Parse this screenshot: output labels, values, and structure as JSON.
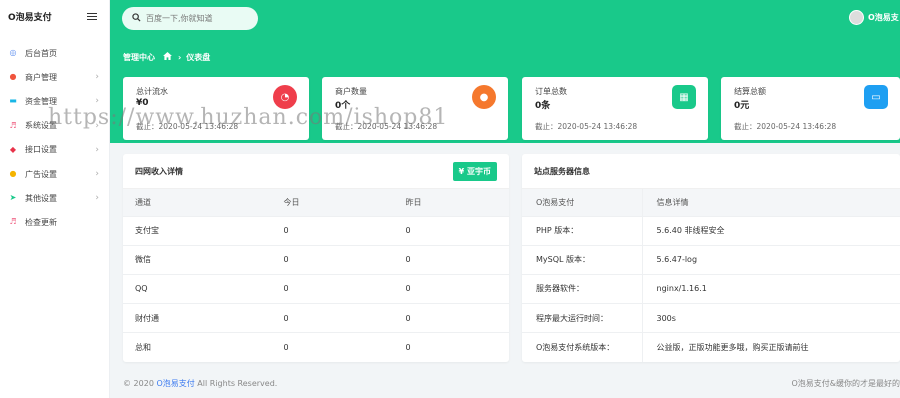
{
  "brand": {
    "name": "O泡易支付"
  },
  "sidebar": {
    "items": [
      {
        "label": "后台首页",
        "icon": "dashboard-icon",
        "color": "#5b8def",
        "has_children": false
      },
      {
        "label": "商户管理",
        "icon": "user-icon",
        "color": "#f0543d",
        "has_children": true
      },
      {
        "label": "资金管理",
        "icon": "card-icon",
        "color": "#19b6e6",
        "has_children": true
      },
      {
        "label": "系统设置",
        "icon": "settings-icon",
        "color": "#f06a8a",
        "has_children": true
      },
      {
        "label": "接口设置",
        "icon": "plug-icon",
        "color": "#e8334a",
        "has_children": true
      },
      {
        "label": "广告设置",
        "icon": "ad-icon",
        "color": "#f5b400",
        "has_children": true
      },
      {
        "label": "其他设置",
        "icon": "send-icon",
        "color": "#19c98a",
        "has_children": true
      },
      {
        "label": "检查更新",
        "icon": "refresh-icon",
        "color": "#f06a8a",
        "has_children": false
      }
    ]
  },
  "search": {
    "placeholder": "百度一下,你就知道"
  },
  "user": {
    "name": "O泡易支"
  },
  "breadcrumb": {
    "section": "管理中心",
    "page": "仪表盘"
  },
  "stats": [
    {
      "title": "总计流水",
      "value": "¥0",
      "sub": "截止：2020-05-24 13:46:28",
      "icon": "pie-icon",
      "color": "#ef3e4b"
    },
    {
      "title": "商户数量",
      "value": "0个",
      "sub": "截止：2020-05-24 13:46:28",
      "icon": "user-icon",
      "color": "#f5782d"
    },
    {
      "title": "订单总数",
      "value": "0条",
      "sub": "截止：2020-05-24 13:46:28",
      "icon": "cart-icon",
      "color": "#19c98a"
    },
    {
      "title": "结算总额",
      "value": "0元",
      "sub": "截止：2020-05-24 13:46:28",
      "icon": "wallet-icon",
      "color": "#1e9ff2"
    }
  ],
  "income": {
    "title": "四网收入详情",
    "button": "¥ 亚宇币",
    "columns": [
      "通道",
      "今日",
      "昨日"
    ],
    "rows": [
      [
        "支付宝",
        "0",
        "0"
      ],
      [
        "微信",
        "0",
        "0"
      ],
      [
        "QQ",
        "0",
        "0"
      ],
      [
        "财付通",
        "0",
        "0"
      ],
      [
        "总和",
        "0",
        "0"
      ]
    ]
  },
  "server": {
    "title": "站点服务器信息",
    "columns": [
      "O泡易支付",
      "信息详情"
    ],
    "rows": [
      [
        "PHP 版本：",
        "5.6.40 非线程安全"
      ],
      [
        "MySQL 版本：",
        "5.6.47-log"
      ],
      [
        "服务器软件：",
        "nginx/1.16.1"
      ],
      [
        "程序最大运行时间：",
        "300s"
      ],
      [
        "O泡易支付系统版本：",
        "公益版，正版功能更多哦，购买正版请前往"
      ]
    ]
  },
  "footer": {
    "copyright": "© 2020",
    "brand_link": "O泡易支付",
    "rights": "All Rights Reserved.",
    "right_text": "O泡易支付&缓你的才是最好的"
  },
  "watermark": "https://www.huzhan.com/ishop81",
  "colors": {
    "accent": "#19c98a",
    "link": "#3d7cf0"
  }
}
